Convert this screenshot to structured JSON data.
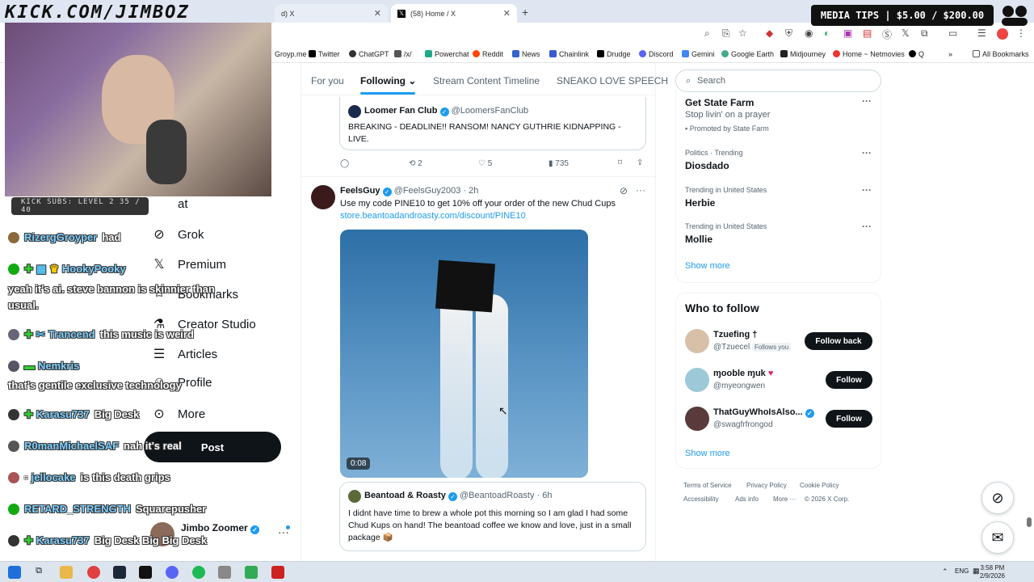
{
  "browser": {
    "tabs": [
      {
        "label": "d) X"
      },
      {
        "label": "(58) Home / X"
      }
    ],
    "bookmarks": [
      "Groyp.me",
      "Twitter",
      "ChatGPT",
      "/x/",
      "Powerchat",
      "Reddit",
      "News",
      "Chainlink",
      "Drudge",
      "Discord",
      "Gemini",
      "Google Earth",
      "Midjourney",
      "Home ~ Netmovies",
      "Q"
    ],
    "all_bookmarks": "All Bookmarks"
  },
  "overlay": {
    "kick_url": "KICK.COM/JIMBOZ",
    "media_tips": "MEDIA TIPS | $5.00 / $200.00",
    "kick_subs": "KICK SUBS: LEVEL 2 35 / 40"
  },
  "chat": [
    {
      "user": "RizergGroyper",
      "msg": "had"
    },
    {
      "user": "HookyPooky",
      "msg": ""
    },
    {
      "user": "",
      "msg": "yeah it's ai. steve bannon is skinnier than"
    },
    {
      "user": "",
      "msg": "usual."
    },
    {
      "user": "Trancend",
      "msg": "this music is weird"
    },
    {
      "user": "Nemkris",
      "msg": ""
    },
    {
      "user": "",
      "msg": "that's gentile exclusive technology"
    },
    {
      "user": "Karasu737",
      "msg": "Big Desk"
    },
    {
      "user": "R0manMichaelSAF",
      "msg": "nah it's real"
    },
    {
      "user": "jellocake",
      "msg": "is this death grips"
    },
    {
      "user": "RETARD_STRENGTH",
      "msg": "Squarepusher"
    },
    {
      "user": "Karasu737",
      "msg": "Big Desk Big Big Desk"
    }
  ],
  "sidebar": {
    "items": [
      {
        "label": "at"
      },
      {
        "label": "Grok"
      },
      {
        "label": "Premium"
      },
      {
        "label": "Bookmarks"
      },
      {
        "label": "Creator Studio"
      },
      {
        "label": "Articles"
      },
      {
        "label": "Profile"
      },
      {
        "label": "More"
      }
    ],
    "post_label": "Post",
    "profile_name": "Jimbo Zoomer"
  },
  "nav_tabs": [
    "For you",
    "Following",
    "Stream Content Timeline",
    "SNEAKO LOVE SPEECH"
  ],
  "feed": {
    "quote1": {
      "name": "Loomer Fan Club",
      "handle": "@LoomersFanClub",
      "text": "BREAKING - DEADLINE!! RANSOM! NANCY GUTHRIE KIDNAPPING - LIVE."
    },
    "actions1": {
      "retweets": "2",
      "likes": "5",
      "views": "735"
    },
    "post": {
      "name": "FeelsGuy",
      "handle": "@FeelsGuy2003",
      "time": "· 2h",
      "text": "Use my code PINE10 to get 10% off your order of the new Chud Cups",
      "link": "store.beantoadandroasty.com/discount/PINE10",
      "video_time": "0:08"
    },
    "quote2": {
      "name": "Beantoad & Roasty",
      "handle": "@BeantoadRoasty",
      "time": "· 6h",
      "text": "I didnt have time to brew a whole pot this morning so I am glad I had some Chud Kups on hand! The beantoad coffee we know and love, just in a small package 📦"
    }
  },
  "right": {
    "search_placeholder": "Search",
    "promo": {
      "title": "Get State Farm",
      "subtitle": "Stop livin' on a prayer",
      "promoted": "Promoted by State Farm"
    },
    "trends": [
      {
        "meta": "Politics · Trending",
        "name": "Diosdado"
      },
      {
        "meta": "Trending in United States",
        "name": "Herbie"
      },
      {
        "meta": "Trending in United States",
        "name": "Mollie"
      }
    ],
    "show_more": "Show more",
    "who_to_follow_title": "Who to follow",
    "who_to_follow": [
      {
        "name": "Tzuefing †",
        "handle": "@Tzuecel",
        "badge": "Follows you",
        "button": "Follow back"
      },
      {
        "name": "ɱooble ɱuk",
        "handle": "@myeongwen",
        "badge": "",
        "button": "Follow"
      },
      {
        "name": "ThatGuyWhoIsAlso...",
        "handle": "@swagfrfrongod",
        "badge": "",
        "button": "Follow"
      }
    ],
    "show_more_2": "Show more",
    "footer": [
      "Terms of Service",
      "Privacy Policy",
      "Cookie Policy",
      "Accessibility",
      "Ads info",
      "More ···",
      "© 2026 X Corp."
    ]
  },
  "taskbar": {
    "time": "3:58 PM",
    "date": "2/9/2026",
    "lang": "ENG"
  },
  "colors": {
    "accent": "#1d9bf0",
    "text": "#0f1419",
    "muted": "#536471"
  }
}
